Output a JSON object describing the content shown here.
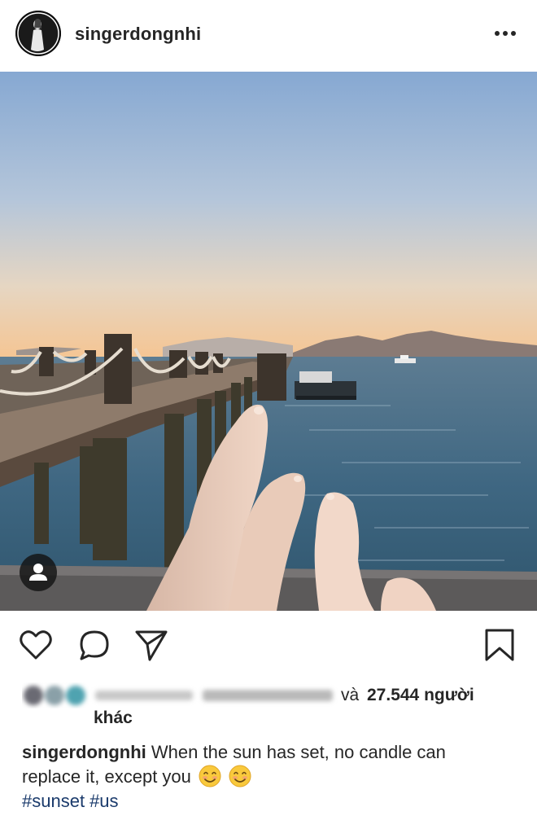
{
  "post": {
    "username": "singerdongnhi",
    "more_icon": "more-horizontal-icon"
  },
  "photo": {
    "alt_icon": "user-tag-icon"
  },
  "actions": {
    "like_icon": "heart-icon",
    "comment_icon": "comment-icon",
    "share_icon": "send-icon",
    "save_icon": "bookmark-icon"
  },
  "likes": {
    "and_text": "và",
    "count": "27.544 người",
    "others": "khác"
  },
  "caption": {
    "username": "singerdongnhi",
    "text_line1": "When the sun has set, no candle can",
    "text_line2": "replace it, except you",
    "emojis": [
      "smiling-face-emoji",
      "smiling-face-emoji"
    ],
    "hashtags": [
      "#sunset",
      "#us"
    ]
  },
  "colors": {
    "text": "#262626",
    "hashtag": "#1a3a6b",
    "sky_top": "#8fb1d6",
    "sky_horizon": "#f4c89a",
    "sea": "#3a5f78"
  }
}
